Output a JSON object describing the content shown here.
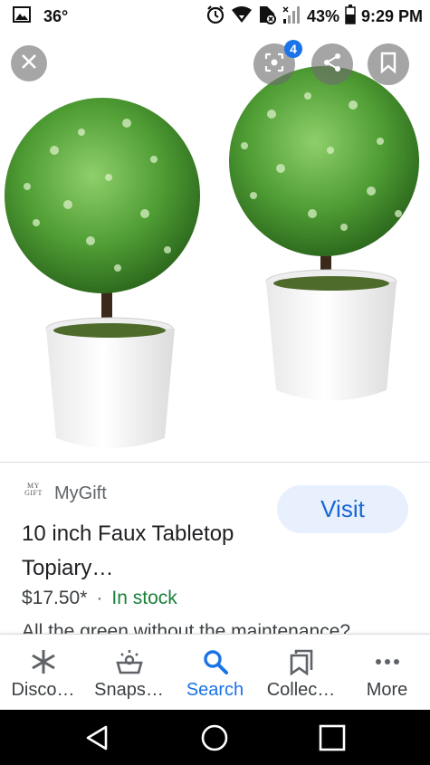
{
  "status_bar": {
    "temperature": "36°",
    "battery": "43%",
    "time": "9:29 PM"
  },
  "viewer": {
    "lens_badge": "4"
  },
  "result": {
    "source_logo": "MY GIFT",
    "source_name": "MyGift",
    "visit_label": "Visit",
    "title": "10 inch Faux Tabletop Topiary…",
    "price": "$17.50*",
    "separator": "·",
    "stock": "In stock",
    "description": "All the green without the maintenance?"
  },
  "bottom_nav": [
    {
      "label": "Disco…",
      "icon": "asterisk-icon"
    },
    {
      "label": "Snaps…",
      "icon": "snapshot-icon"
    },
    {
      "label": "Search",
      "icon": "search-icon"
    },
    {
      "label": "Collec…",
      "icon": "collections-icon"
    },
    {
      "label": "More",
      "icon": "more-icon"
    }
  ],
  "colors": {
    "accent": "#1a73e8",
    "stock": "#188038",
    "visit_bg": "#e8f0fe"
  }
}
